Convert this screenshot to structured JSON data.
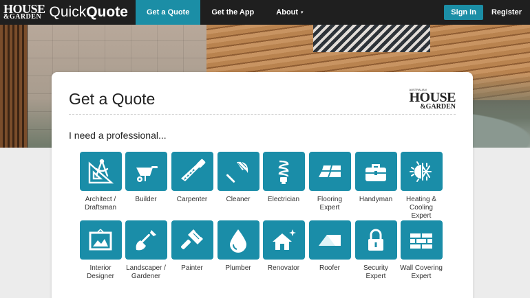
{
  "nav": {
    "logo_house": "HOUSE",
    "logo_garden": "&GARDEN",
    "logo_quick": "Quick",
    "logo_quote": "Quote",
    "items": [
      {
        "label": "Get a Quote",
        "active": true
      },
      {
        "label": "Get the App",
        "active": false
      },
      {
        "label": "About",
        "active": false,
        "caret": "▾"
      }
    ],
    "signin": "Sign In",
    "register": "Register"
  },
  "card": {
    "title": "Get a Quote",
    "logo_small": "AUSTRALIAN",
    "logo_big": "HOUSE",
    "logo_sub": "&GARDEN",
    "subtitle": "I need a professional..."
  },
  "professions": [
    {
      "label": "Architect /\nDraftsman",
      "icon": "compass-ruler-icon"
    },
    {
      "label": "Builder",
      "icon": "wheelbarrow-icon"
    },
    {
      "label": "Carpenter",
      "icon": "saw-icon"
    },
    {
      "label": "Cleaner",
      "icon": "feather-duster-icon"
    },
    {
      "label": "Electrician",
      "icon": "lightbulb-icon"
    },
    {
      "label": "Flooring\nExpert",
      "icon": "floor-tiles-icon"
    },
    {
      "label": "Handyman",
      "icon": "toolbox-icon"
    },
    {
      "label": "Heating &\nCooling Expert",
      "icon": "sun-snowflake-icon"
    },
    {
      "label": "Interior\nDesigner",
      "icon": "picture-frame-icon"
    },
    {
      "label": "Landscaper /\nGardener",
      "icon": "shovel-icon"
    },
    {
      "label": "Painter",
      "icon": "paintbrush-icon"
    },
    {
      "label": "Plumber",
      "icon": "water-drop-icon"
    },
    {
      "label": "Renovator",
      "icon": "house-sparkle-icon"
    },
    {
      "label": "Roofer",
      "icon": "roof-icon"
    },
    {
      "label": "Security\nExpert",
      "icon": "padlock-icon"
    },
    {
      "label": "Wall Covering\nExpert",
      "icon": "bricks-icon"
    }
  ],
  "colors": {
    "accent": "#1b8ea6",
    "tile": "#1a8da8",
    "nav_bg": "#1f1f1f"
  }
}
